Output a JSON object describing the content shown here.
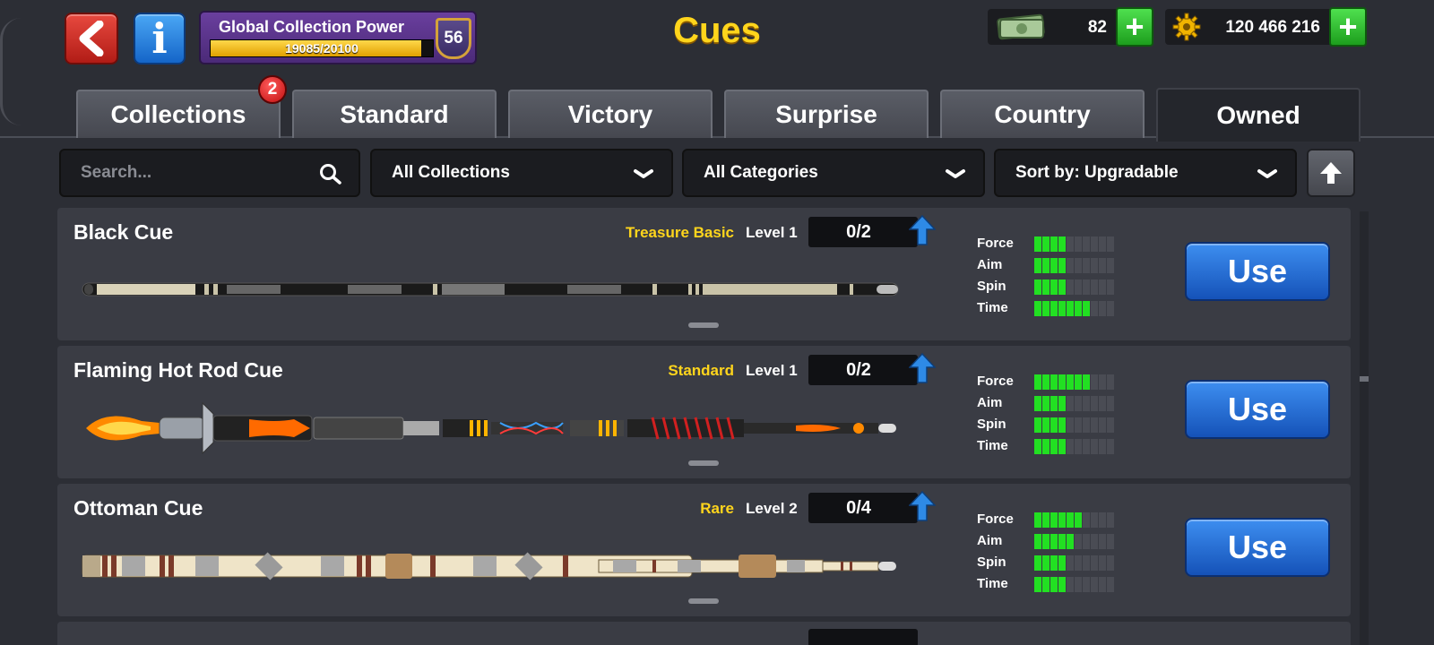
{
  "header": {
    "back_button_label": "",
    "info_button_label": "i",
    "page_title": "Cues",
    "collection_power": {
      "title": "Global Collection Power",
      "progress_text": "19085/20100",
      "progress": 0.9495,
      "level": "56"
    },
    "cash": {
      "value": "82",
      "icon": "cash-icon"
    },
    "coins": {
      "value": "120 466 216",
      "icon": "gear-coin-icon"
    },
    "plus_label": "+"
  },
  "tabs": [
    {
      "label": "Collections",
      "active": false
    },
    {
      "label": "Standard",
      "active": false
    },
    {
      "label": "Victory",
      "active": false
    },
    {
      "label": "Surprise",
      "active": false
    },
    {
      "label": "Country",
      "active": false
    },
    {
      "label": "Owned",
      "active": true
    }
  ],
  "collections_badge": "2",
  "filters": {
    "search_placeholder": "Search...",
    "collection": "All Collections",
    "category": "All Categories",
    "sort": "Sort by: Upgradable"
  },
  "stat_labels": [
    "Force",
    "Aim",
    "Spin",
    "Time"
  ],
  "use_label": "Use",
  "colors": {
    "accent_yellow": "#ffd51c",
    "stat_green": "#22e022",
    "use_blue": "#1e6fd9"
  },
  "cues": [
    {
      "name": "Black Cue",
      "rarity": "Treasure Basic",
      "level": "Level 1",
      "progress": "0/2",
      "stats": {
        "force": 4,
        "aim": 4,
        "spin": 4,
        "time": 7
      }
    },
    {
      "name": "Flaming Hot Rod Cue",
      "rarity": "Standard",
      "level": "Level 1",
      "progress": "0/2",
      "stats": {
        "force": 7,
        "aim": 4,
        "spin": 4,
        "time": 4
      }
    },
    {
      "name": "Ottoman Cue",
      "rarity": "Rare",
      "level": "Level 2",
      "progress": "0/4",
      "stats": {
        "force": 6,
        "aim": 5,
        "spin": 4,
        "time": 4
      }
    }
  ]
}
